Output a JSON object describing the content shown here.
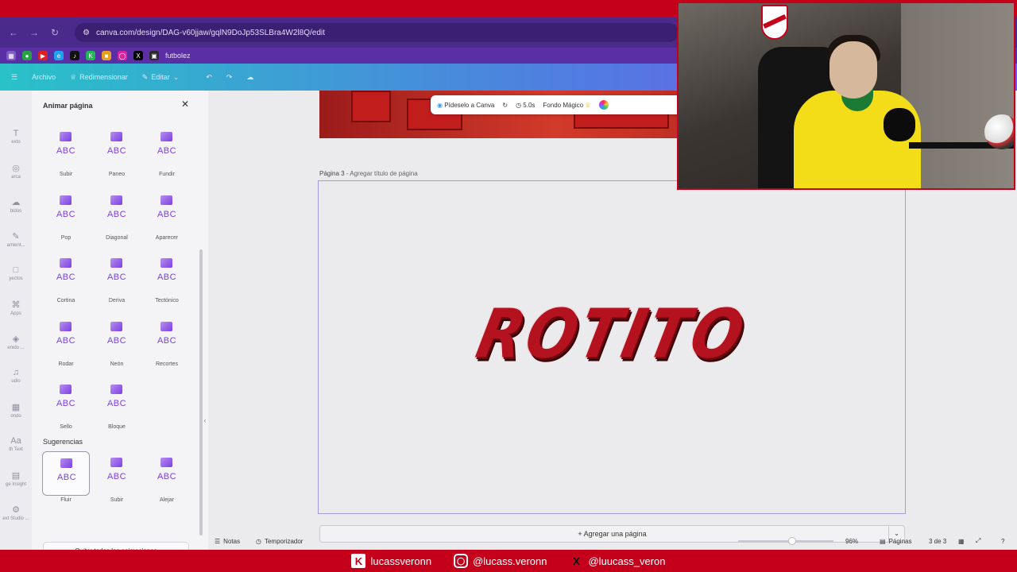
{
  "browser": {
    "url": "canva.com/design/DAG-v60jjaw/gqlN9DoJp53SLBra4W2l8Q/edit",
    "bookmark_label": "futbolez"
  },
  "toolbar": {
    "archivo": "Archivo",
    "redimensionar": "Redimensionar",
    "editar": "Editar"
  },
  "rail": [
    {
      "label": "exto",
      "icon": "text-icon"
    },
    {
      "label": "arca",
      "icon": "brand-icon"
    },
    {
      "label": "bidos",
      "icon": "uploads-icon"
    },
    {
      "label": "amient...",
      "icon": "draw-icon"
    },
    {
      "label": "yectos",
      "icon": "projects-icon"
    },
    {
      "label": "Apps",
      "icon": "apps-icon"
    },
    {
      "label": "enido ...",
      "icon": "content-icon"
    },
    {
      "label": "udio",
      "icon": "audio-icon"
    },
    {
      "label": "ondo",
      "icon": "background-icon"
    },
    {
      "label": "th Text",
      "icon": "text-effect-icon"
    },
    {
      "label": "ge Insight",
      "icon": "insight-icon"
    },
    {
      "label": "ext Studio ...",
      "icon": "studio-icon"
    }
  ],
  "panel": {
    "title": "Animar página",
    "animations": [
      {
        "label": "Subir",
        "abc": "ABC"
      },
      {
        "label": "Paneo",
        "abc": "ABC"
      },
      {
        "label": "Fundir",
        "abc": "ABC"
      },
      {
        "label": "Pop",
        "abc": "ABC"
      },
      {
        "label": "Diagonal",
        "abc": "ABC"
      },
      {
        "label": "Aparecer",
        "abc": "ABC"
      },
      {
        "label": "Cortina",
        "abc": "ABC"
      },
      {
        "label": "Deriva",
        "abc": "ABC"
      },
      {
        "label": "Tectónico",
        "abc": "ABC"
      },
      {
        "label": "Rodar",
        "abc": "ABC"
      },
      {
        "label": "Neón",
        "abc": "ABC"
      },
      {
        "label": "Recortes",
        "abc": "ABC"
      },
      {
        "label": "Sello",
        "abc": "ABC"
      },
      {
        "label": "Bloque",
        "abc": "ABC"
      }
    ],
    "suggestions_title": "Sugerencias",
    "suggestions": [
      {
        "label": "Fluir",
        "abc": "ABC"
      },
      {
        "label": "Subir",
        "abc": "ABC"
      },
      {
        "label": "Alejar",
        "abc": "ABC"
      }
    ],
    "remove_all": "Quitar todas las animaciones"
  },
  "context_bar": {
    "ask": "Pídeselo a Canva",
    "duration": "5.0s",
    "magic_bg": "Fondo Mágico"
  },
  "page": {
    "label_number": "Página 3",
    "label_title_placeholder": "Agregar título de página",
    "headline": "ROTITO",
    "add_page": "+ Agregar una página"
  },
  "bottom_bar": {
    "notes": "Notas",
    "timer": "Temporizador",
    "zoom": "96%",
    "pages_label": "Páginas",
    "page_count": "3 de 3"
  },
  "footer": {
    "kick": "lucassveronn",
    "instagram": "@lucass.veronn",
    "x": "@luucass_veron"
  },
  "colors": {
    "accent": "#7b3fe4",
    "frame": "#c4001a",
    "headline": "#b3121e"
  }
}
